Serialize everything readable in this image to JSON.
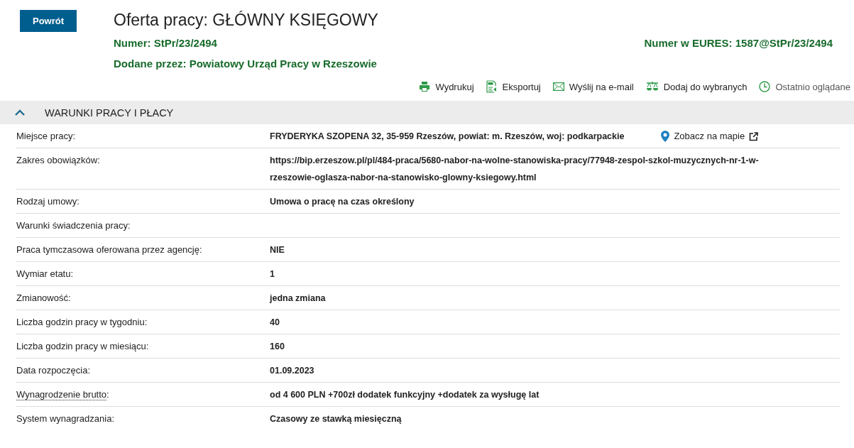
{
  "back_button": "Powrót",
  "title": "Oferta pracy: GŁÓWNY KSIĘGOWY",
  "number": {
    "label": "Numer:",
    "value": "StPr/23/2494"
  },
  "eures": {
    "label": "Numer w EURES:",
    "value": "1587@StPr/23/2494"
  },
  "added_by": {
    "label": "Dodane przez:",
    "value": "Powiatowy Urząd Pracy w Rzeszowie"
  },
  "actions": [
    {
      "kind": "print",
      "label": "Wydrukuj"
    },
    {
      "kind": "pdf",
      "label": "Eksportuj"
    },
    {
      "kind": "mail",
      "label": "Wyślij na e-mail"
    },
    {
      "kind": "favorite",
      "label": "Dodaj do wybranych"
    },
    {
      "kind": "history",
      "label": "Ostatnio oglądane"
    }
  ],
  "section": {
    "title": "WARUNKI PRACY I PŁACY",
    "expanded": true,
    "rows": [
      {
        "label": "Miejsce pracy:",
        "value": "FRYDERYKA SZOPENA 32, 35-959 Rzeszów, powiat: m. Rzeszów, woj: podkarpackie",
        "map_link": "Zobacz na mapie",
        "hint": false
      },
      {
        "label": "Zakres obowiązków:",
        "value": "https://bip.erzeszow.pl/pl/484-praca/5680-nabor-na-wolne-stanowiska-pracy/77948-zespol-szkol-muzycznych-nr-1-w-rzeszowie-oglasza-nabor-na-stanowisko-glowny-ksiegowy.html",
        "hint": false
      },
      {
        "label": "Rodzaj umowy:",
        "value": "Umowa o pracę na czas określony",
        "hint": false
      },
      {
        "label": "Warunki świadczenia pracy:",
        "hint": false
      },
      {
        "label": "Praca tymczasowa oferowana przez agencję:",
        "value": "NIE",
        "hint": false
      },
      {
        "label": "Wymiar etatu:",
        "value": "1",
        "hint": false
      },
      {
        "label": "Zmianowość:",
        "value": "jedna zmiana",
        "hint": false
      },
      {
        "label": "Liczba godzin pracy w tygodniu:",
        "value": "40",
        "hint": false
      },
      {
        "label": "Liczba godzin pracy w miesiącu:",
        "value": "160",
        "hint": false
      },
      {
        "label": "Data rozpoczęcia:",
        "value": "01.09.2023",
        "hint": false
      },
      {
        "label": "Wynagrodzenie brutto",
        "label_suffix": ":",
        "value": "od 4 600 PLN +700zł dodatek funkcyjny +dodatek za wysługę lat",
        "hint": true
      },
      {
        "label": "System wynagradzania:",
        "value": "Czasowy ze stawką miesięczną",
        "hint": false
      }
    ]
  }
}
